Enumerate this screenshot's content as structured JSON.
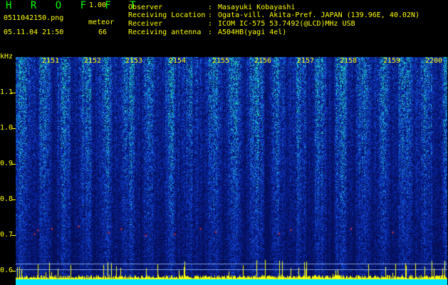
{
  "app": {
    "title": "H R O F F T",
    "version": "1.00"
  },
  "file": {
    "name": "0511042150.png",
    "datetime": "05.11.04 21:50"
  },
  "meteor": {
    "label": "meteor",
    "count": "66"
  },
  "info": [
    {
      "label": "Observer",
      "value": "Masayuki Kobayashi"
    },
    {
      "label": "Receiving Location",
      "value": "Ogata-vill. Akita-Pref. JAPAN (139.96E, 40.02N)"
    },
    {
      "label": "Receiver",
      "value": "ICOM IC-575 53.7492(@LCD)MHz USB"
    },
    {
      "label": "Receiving antenna",
      "value": "A504HB(yagi 4el)"
    }
  ],
  "colon": ":",
  "axis": {
    "y_unit": "kHz",
    "y_ticks": [
      "1.1",
      "1.0",
      "0.9",
      "0.8",
      "0.7",
      "0.6"
    ],
    "x_ticks": [
      "2151",
      "2152",
      "2153",
      "2154",
      "2155",
      "2156",
      "2157",
      "2158",
      "2159",
      "2200"
    ]
  },
  "colors": {
    "background": "#000000",
    "text": "#ffff00",
    "title": "#00ff00",
    "spectrogram_low": "#0a1a7a",
    "spectrogram_high": "#00ffa0",
    "signal_line": "#ffff00",
    "baseline": "#00e0ff"
  }
}
